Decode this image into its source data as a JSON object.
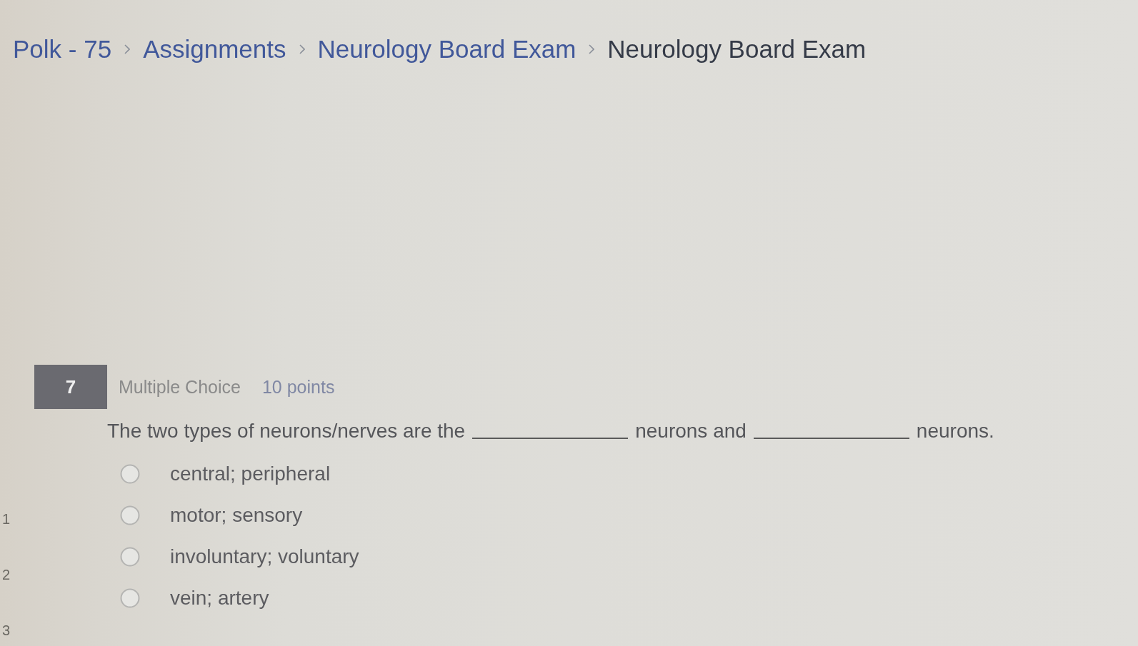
{
  "breadcrumb": [
    {
      "label": "Polk - 75",
      "current": false
    },
    {
      "label": "Assignments",
      "current": false
    },
    {
      "label": "Neurology Board Exam",
      "current": false
    },
    {
      "label": "Neurology Board Exam",
      "current": true
    }
  ],
  "question_nav": [
    "1",
    "2",
    "3"
  ],
  "question": {
    "number": "7",
    "type": "Multiple Choice",
    "points": "10 points",
    "prompt": [
      {
        "kind": "text",
        "text": "The two types of neurons/nerves are the"
      },
      {
        "kind": "blank"
      },
      {
        "kind": "text",
        "text": "neurons and"
      },
      {
        "kind": "blank"
      },
      {
        "kind": "text",
        "text": "neurons."
      }
    ],
    "options": [
      {
        "label": "central; peripheral",
        "selected": false
      },
      {
        "label": "motor; sensory",
        "selected": false
      },
      {
        "label": "involuntary; voluntary",
        "selected": false
      },
      {
        "label": "vein; artery",
        "selected": false
      }
    ]
  }
}
